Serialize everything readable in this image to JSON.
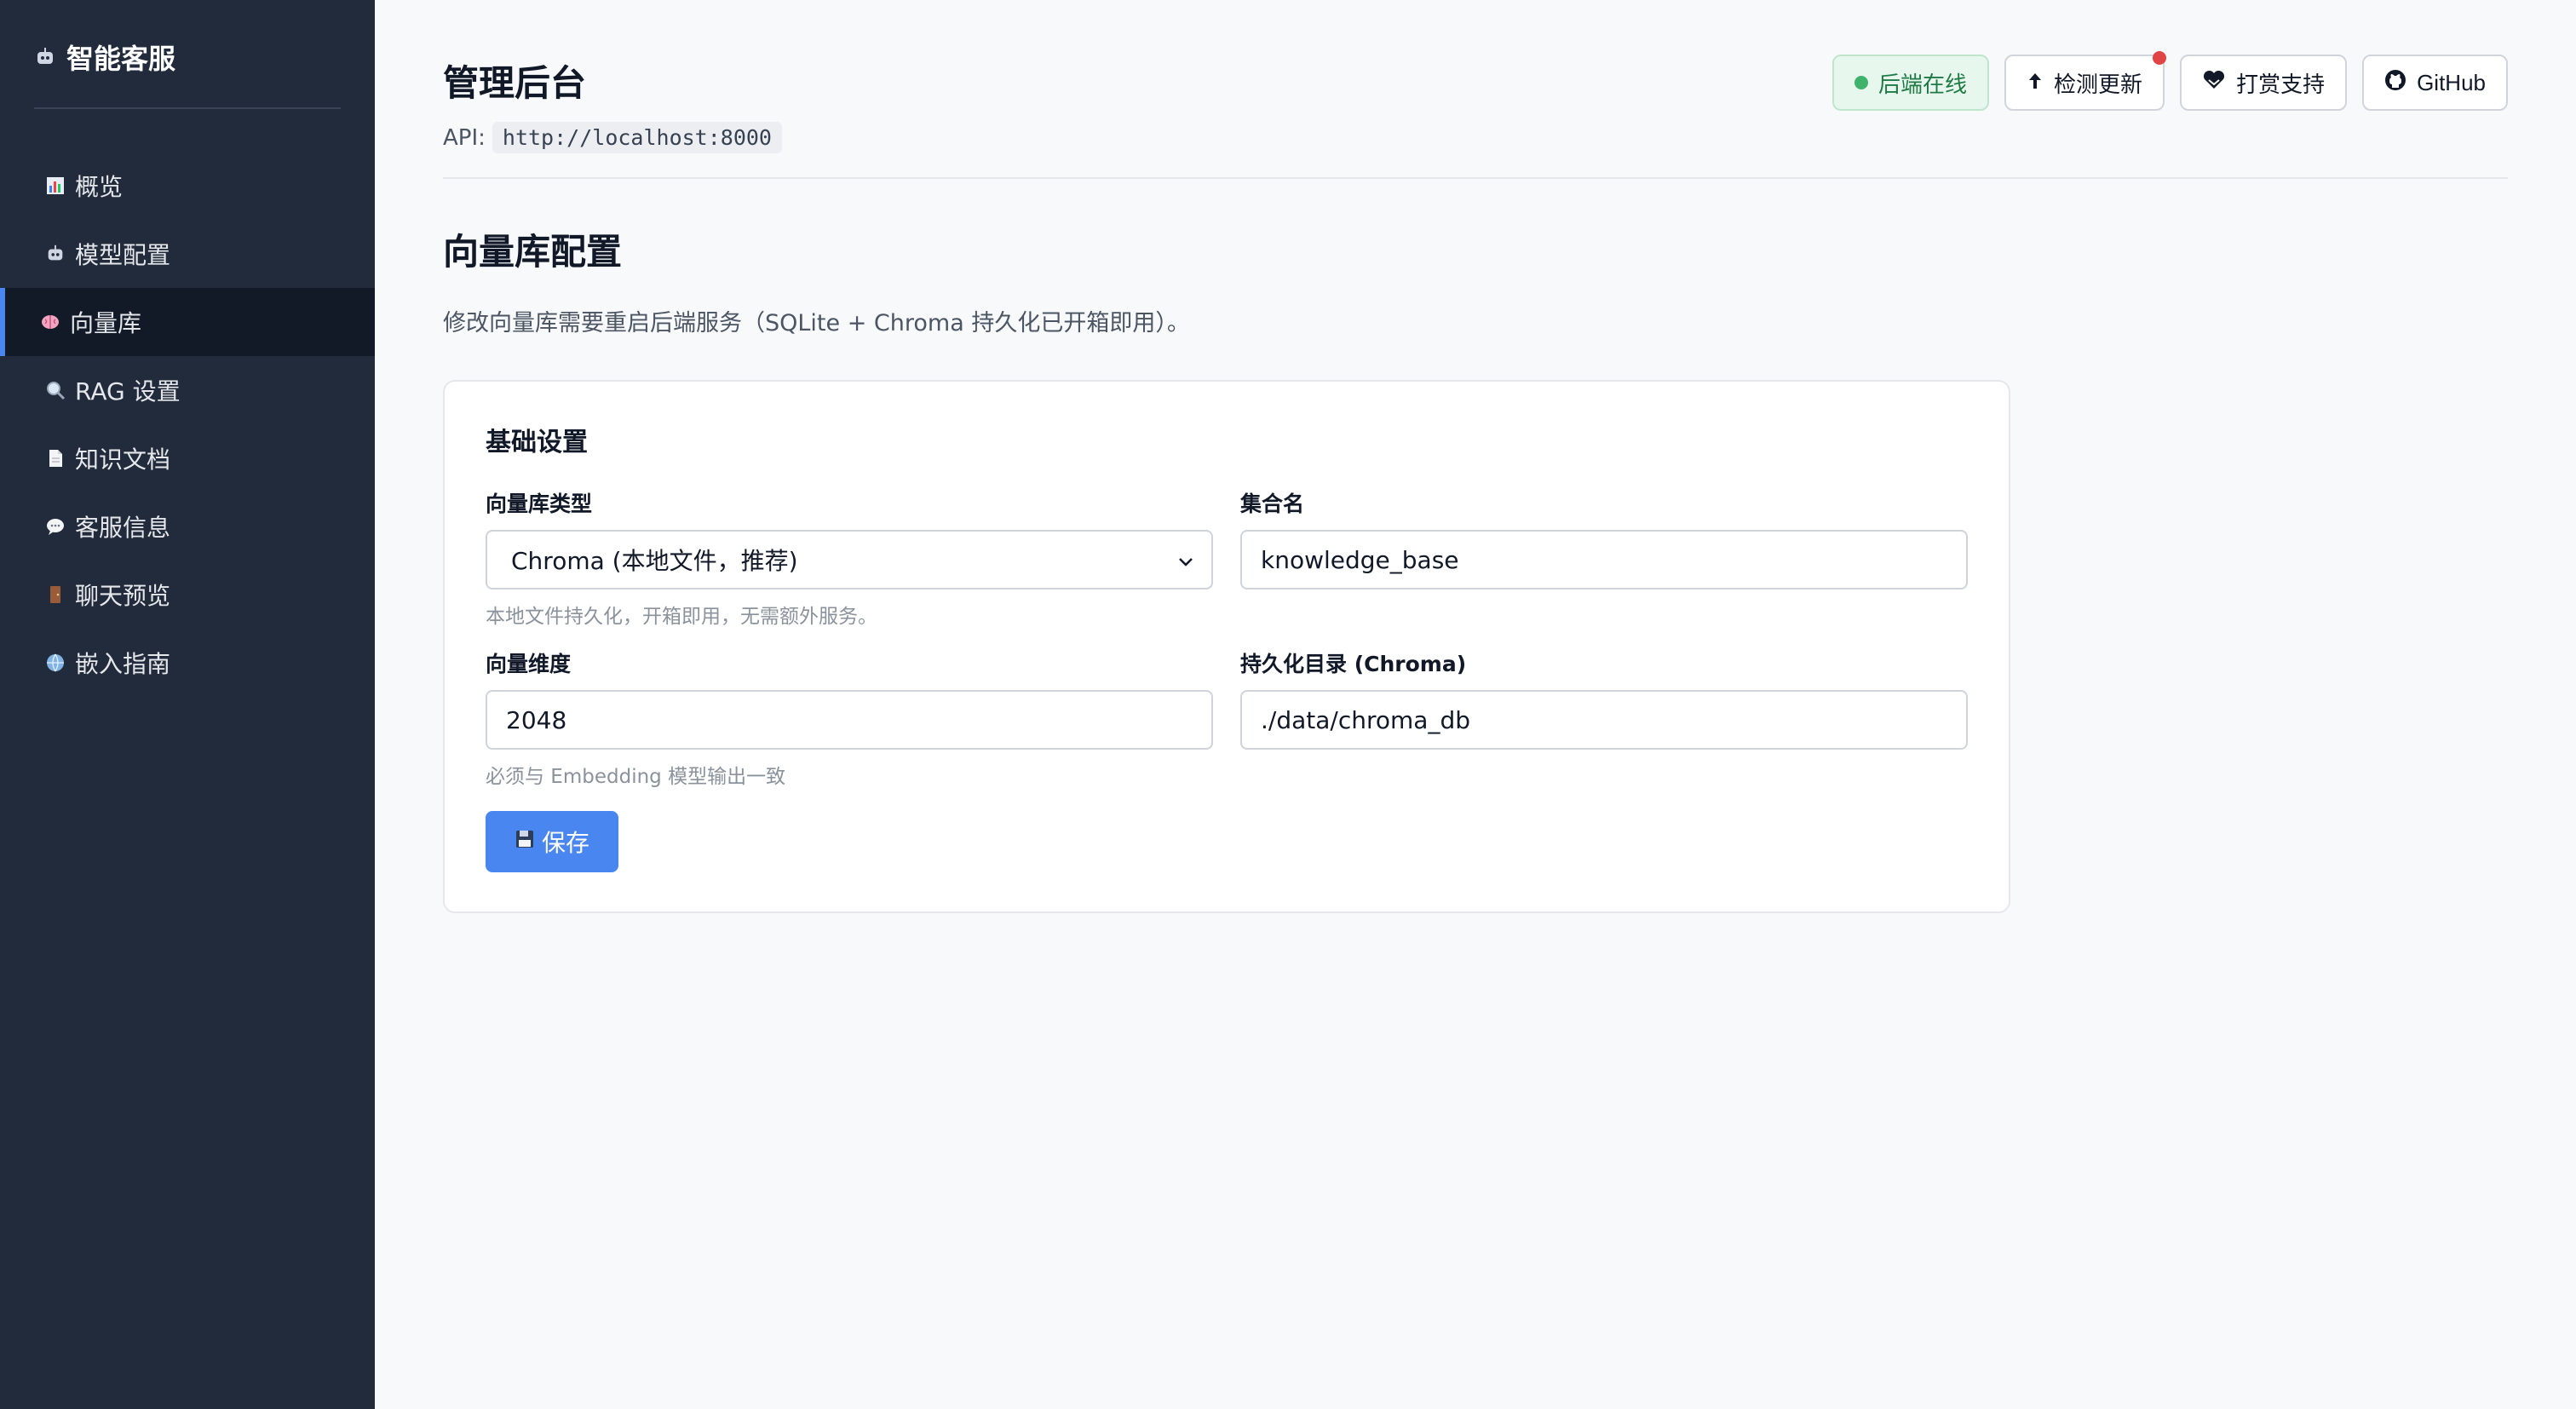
{
  "sidebar": {
    "brand": "智能客服",
    "items": [
      {
        "label": "概览",
        "icon": "bar-chart-icon"
      },
      {
        "label": "模型配置",
        "icon": "robot-icon"
      },
      {
        "label": "向量库",
        "icon": "brain-icon",
        "active": true
      },
      {
        "label": "RAG 设置",
        "icon": "magnifier-icon"
      },
      {
        "label": "知识文档",
        "icon": "document-icon"
      },
      {
        "label": "客服信息",
        "icon": "speech-bubble-icon"
      },
      {
        "label": "聊天预览",
        "icon": "door-icon"
      },
      {
        "label": "嵌入指南",
        "icon": "globe-icon"
      }
    ]
  },
  "header": {
    "title": "管理后台",
    "api_label": "API:",
    "api_url": "http://localhost:8000",
    "status": "后端在线",
    "check_update": "检测更新",
    "donate": "打赏支持",
    "github": "GitHub"
  },
  "page": {
    "title": "向量库配置",
    "subtitle": "修改向量库需要重启后端服务（SQLite + Chroma 持久化已开箱即用）。"
  },
  "card": {
    "title": "基础设置",
    "vector_type_label": "向量库类型",
    "vector_type_value": "Chroma (本地文件，推荐)",
    "vector_type_hint": "本地文件持久化，开箱即用，无需额外服务。",
    "collection_label": "集合名",
    "collection_value": "knowledge_base",
    "dimension_label": "向量维度",
    "dimension_value": "2048",
    "dimension_hint": "必须与 Embedding 模型输出一致",
    "persist_label": "持久化目录 (Chroma)",
    "persist_value": "./data/chroma_db",
    "save_label": "保存"
  },
  "colors": {
    "sidebar_bg": "#222b3b",
    "accent": "#4a86f0",
    "status_green": "#3fb36c",
    "badge_red": "#e04444"
  }
}
